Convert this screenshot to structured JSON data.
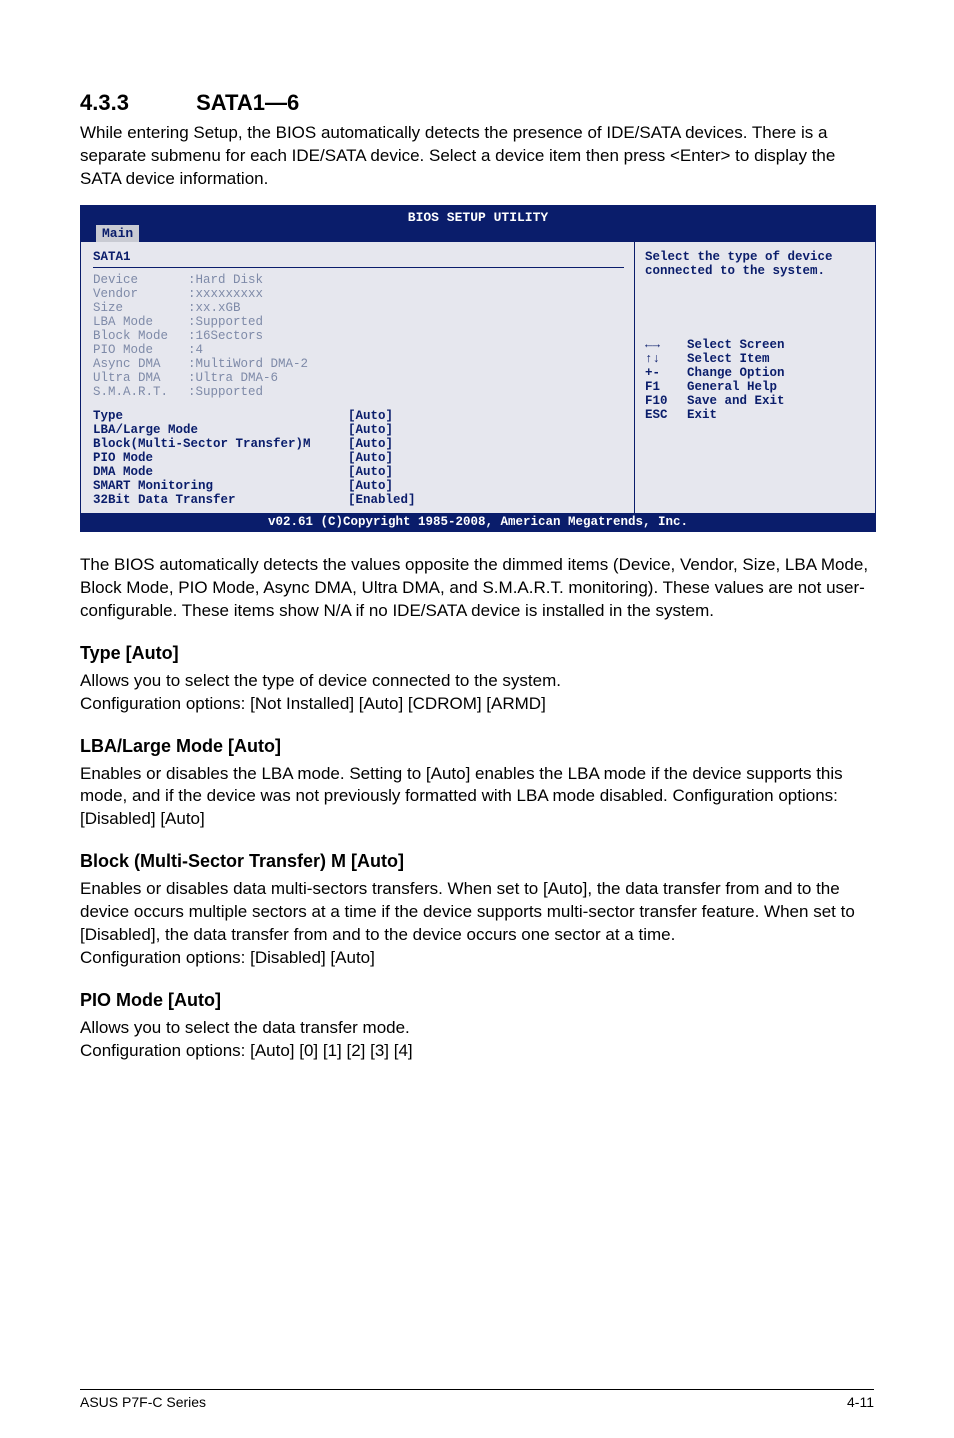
{
  "section": {
    "number": "4.3.3",
    "title": "SATA1—6"
  },
  "intro": "While entering Setup, the BIOS automatically detects the presence of IDE/SATA devices. There is a separate submenu for each IDE/SATA device. Select a device item then press <Enter> to display the SATA device information.",
  "bios": {
    "utility_title": "BIOS SETUP UTILITY",
    "tab": "Main",
    "panel_title": "SATA1",
    "dimmed": [
      {
        "label": "Device",
        "value": ":Hard Disk"
      },
      {
        "label": "Vendor",
        "value": ":xxxxxxxxx"
      },
      {
        "label": "Size",
        "value": ":xx.xGB"
      },
      {
        "label": "LBA Mode",
        "value": ":Supported"
      },
      {
        "label": "Block Mode",
        "value": ":16Sectors"
      },
      {
        "label": "PIO Mode",
        "value": ":4"
      },
      {
        "label": "Async DMA",
        "value": ":MultiWord DMA-2"
      },
      {
        "label": "Ultra DMA",
        "value": ":Ultra DMA-6"
      },
      {
        "label": "S.M.A.R.T.",
        "value": ":Supported"
      }
    ],
    "config": [
      {
        "label": "Type",
        "value": "[Auto]",
        "selected": true
      },
      {
        "label": "LBA/Large Mode",
        "value": "[Auto]"
      },
      {
        "label": "Block(Multi-Sector Transfer)M",
        "value": "[Auto]"
      },
      {
        "label": "PIO Mode",
        "value": "[Auto]"
      },
      {
        "label": "DMA Mode",
        "value": "[Auto]"
      },
      {
        "label": "SMART Monitoring",
        "value": "[Auto]"
      },
      {
        "label": "32Bit Data Transfer",
        "value": "[Enabled]"
      }
    ],
    "help_text": "Select the type of device connected to the system.",
    "nav": [
      {
        "key": "←→",
        "desc": "Select Screen"
      },
      {
        "key": "↑↓",
        "desc": "Select Item"
      },
      {
        "key": "+-",
        "desc": "Change Option"
      },
      {
        "key": "F1",
        "desc": "General Help"
      },
      {
        "key": "F10",
        "desc": "Save and Exit"
      },
      {
        "key": "ESC",
        "desc": "Exit"
      }
    ],
    "footer": "v02.61 (C)Copyright 1985-2008, American Megatrends, Inc."
  },
  "after_bios": "The BIOS automatically detects the values opposite the dimmed items (Device, Vendor, Size, LBA Mode, Block Mode, PIO Mode, Async DMA, Ultra DMA, and S.M.A.R.T. monitoring). These values are not user-configurable. These items show N/A if no IDE/SATA device is installed in the system.",
  "subsections": [
    {
      "title": "Type [Auto]",
      "paras": [
        "Allows you to select the type of device connected to the system.",
        "Configuration options: [Not Installed] [Auto] [CDROM] [ARMD]"
      ]
    },
    {
      "title": "LBA/Large Mode [Auto]",
      "paras": [
        "Enables or disables the LBA mode. Setting to [Auto] enables the LBA mode if the device supports this mode, and if the device was not previously formatted with LBA mode disabled. Configuration options: [Disabled] [Auto]"
      ]
    },
    {
      "title": "Block (Multi-Sector Transfer) M [Auto]",
      "paras": [
        "Enables or disables data multi-sectors transfers. When set to [Auto], the data transfer from and to the device occurs multiple sectors at a time if the device supports multi-sector transfer feature. When set to [Disabled], the data transfer from and to the device occurs one sector at a time.",
        "Configuration options: [Disabled] [Auto]"
      ]
    },
    {
      "title": "PIO Mode [Auto]",
      "paras": [
        "Allows you to select the data transfer mode.",
        "Configuration options: [Auto] [0] [1] [2] [3] [4]"
      ]
    }
  ],
  "footer": {
    "left": "ASUS P7F-C Series",
    "right": "4-11"
  }
}
